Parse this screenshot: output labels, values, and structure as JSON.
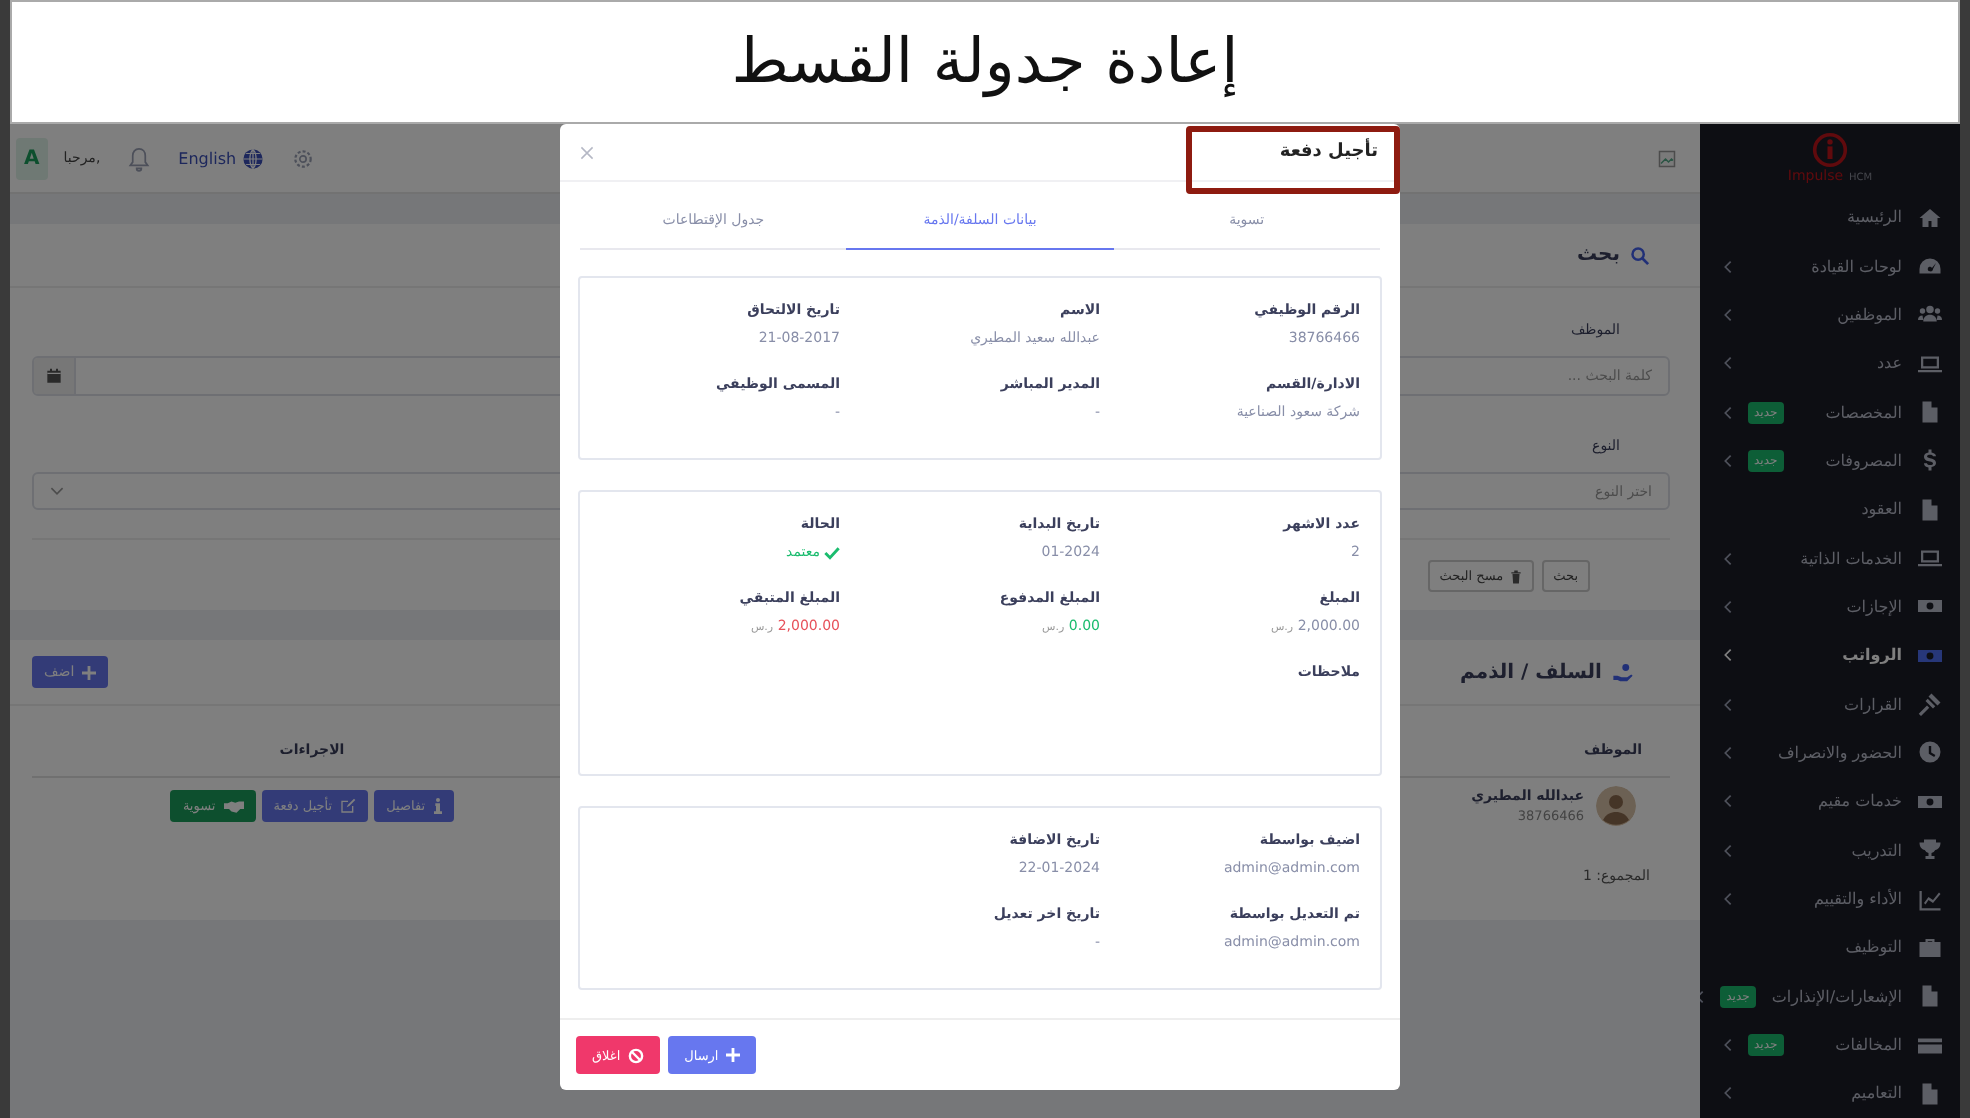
{
  "slide_title": "إعادة جدولة القسط",
  "header": {
    "user_initial": "A",
    "greeting": "مرحبا,",
    "language": "English"
  },
  "search_card": {
    "title": "بحث",
    "employee_label": "الموظف",
    "employee_placeholder": "كلمة البحث ...",
    "type_label": "النوع",
    "type_placeholder": "اختر النوع",
    "buttons": [
      "بحث",
      "مسح البحث"
    ]
  },
  "advances": {
    "title": "السلف / الذمم",
    "add_button": "اضف",
    "columns": [
      "الموظف",
      "الاجراءات"
    ],
    "rows": [
      {
        "name": "عبدالله المطيري",
        "id": "38766466",
        "actions": [
          {
            "label": "تفاصيل",
            "kind": "primary"
          },
          {
            "label": "تأجيل دفعة",
            "kind": "primary"
          },
          {
            "label": "تسوية",
            "kind": "success"
          }
        ]
      }
    ],
    "total": "المجموع: 1"
  },
  "sidebar": {
    "logo": "Impulse",
    "logo_suffix": "HCM",
    "items": [
      {
        "label": "الرئيسية",
        "submenu": false,
        "selected": false
      },
      {
        "label": "لوحات القيادة",
        "submenu": true,
        "selected": false
      },
      {
        "label": "الموظفين",
        "submenu": true,
        "selected": false
      },
      {
        "label": "عدد",
        "submenu": true,
        "selected": false
      },
      {
        "label": "المخصصات",
        "submenu": true,
        "badge": "جديد",
        "selected": false
      },
      {
        "label": "المصروفات",
        "submenu": true,
        "badge": "جديد",
        "selected": false
      },
      {
        "label": "العقود",
        "submenu": false,
        "selected": false
      },
      {
        "label": "الخدمات الذاتية",
        "submenu": true,
        "selected": false
      },
      {
        "label": "الإجازات",
        "submenu": true,
        "selected": false
      },
      {
        "label": "الرواتب",
        "submenu": true,
        "selected": true
      },
      {
        "label": "القرارات",
        "submenu": true,
        "selected": false
      },
      {
        "label": "الحضور والانصراف",
        "submenu": true,
        "selected": false
      },
      {
        "label": "خدمات مقيم",
        "submenu": true,
        "selected": false
      },
      {
        "label": "التدريب",
        "submenu": true,
        "selected": false
      },
      {
        "label": "الأداء والتقييم",
        "submenu": true,
        "selected": false
      },
      {
        "label": "التوظيف",
        "submenu": false,
        "selected": false
      },
      {
        "label": "الإشعارات/الإنذارات",
        "submenu": true,
        "badge": "جديد",
        "selected": false
      },
      {
        "label": "المخالفات",
        "submenu": true,
        "badge": "جديد",
        "selected": false
      },
      {
        "label": "التعاميم",
        "submenu": true,
        "selected": false
      }
    ]
  },
  "modal": {
    "title": "تأجيل دفعة",
    "tabs": [
      {
        "label": "تسوية",
        "selected": false
      },
      {
        "label": "بيانات السلفة/الذمة",
        "selected": true
      },
      {
        "label": "جدول الإقتطاعات",
        "selected": false
      }
    ],
    "cards": [
      [
        [
          {
            "label": "الرقم الوظيفي",
            "value": "38766466",
            "kind": "text"
          },
          {
            "label": "الاسم",
            "value": "عبدالله سعيد المطيري",
            "kind": "text"
          },
          {
            "label": "تاريخ الالتحاق",
            "value": "21-08-2017",
            "kind": "text"
          }
        ],
        [
          {
            "label": "الادارة/القسم",
            "value": "شركة سعود الصناعية",
            "kind": "text"
          },
          {
            "label": "المدير المباشر",
            "value": "-",
            "kind": "text"
          },
          {
            "label": "المسمى الوظيفي",
            "value": "-",
            "kind": "text"
          }
        ]
      ],
      [
        [
          {
            "label": "عدد الاشهر",
            "value": "2",
            "kind": "text"
          },
          {
            "label": "تاريخ البداية",
            "value": "01-2024",
            "kind": "text"
          },
          {
            "label": "الحالة",
            "value": "معتمد",
            "kind": "status",
            "color": "#1abc6e"
          }
        ],
        [
          {
            "label": "المبلغ",
            "value": "2,000.00",
            "unit": "ر.س",
            "kind": "money",
            "color": "#888ea8"
          },
          {
            "label": "المبلغ المدفوع",
            "value": "0.00",
            "unit": "ر.س",
            "kind": "money",
            "color": "#1abc6e"
          },
          {
            "label": "المبلغ المتبقي",
            "value": "2,000.00",
            "unit": "ر.س",
            "kind": "money",
            "color": "#e7515a"
          }
        ],
        [
          {
            "label": "ملاحظات"
          }
        ]
      ],
      [
        [
          {
            "label": "اضيف بواسطة",
            "value": "admin@admin.com",
            "kind": "text"
          },
          {
            "label": "تاريخ الاضافة",
            "value": "22-01-2024",
            "kind": "text"
          }
        ],
        [
          {
            "label": "تم التعديل بواسطة",
            "value": "admin@admin.com",
            "kind": "text"
          },
          {
            "label": "تاريخ اخر تعديل",
            "value": "-",
            "kind": "text"
          }
        ]
      ]
    ],
    "buttons": [
      {
        "label": "ارسال",
        "kind": "primary"
      },
      {
        "label": "اغلاق",
        "kind": "danger"
      }
    ]
  }
}
